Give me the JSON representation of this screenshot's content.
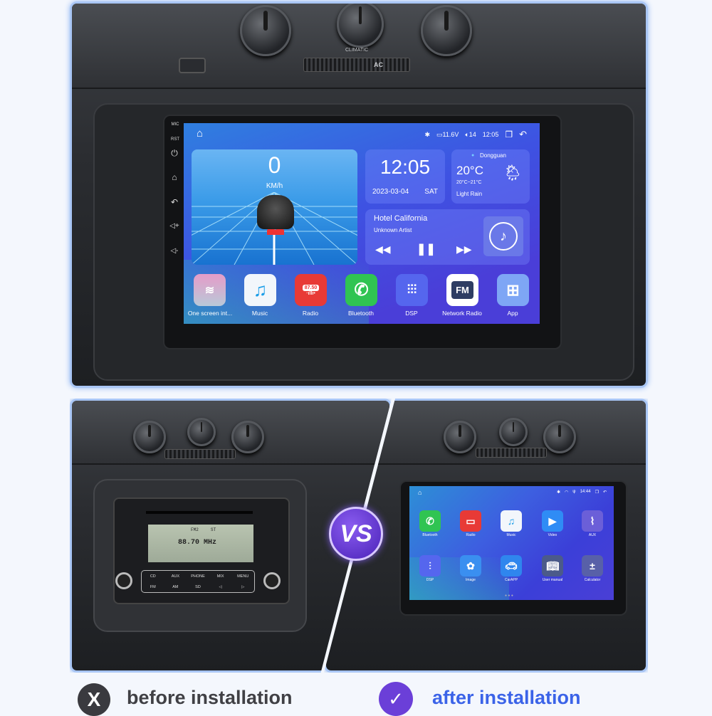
{
  "top_panel": {
    "climate_label": "CLIMATIC",
    "ac_label": "AC",
    "bezel_labels": {
      "mic": "MIC",
      "rst": "RST"
    },
    "status_bar": {
      "voltage": "11.6V",
      "volume": "14",
      "time": "12:05"
    },
    "speed": {
      "value": "0",
      "unit": "KM/h"
    },
    "clock": {
      "time": "12:05",
      "date": "2023-03-04",
      "day": "SAT"
    },
    "weather": {
      "city": "Dongguan",
      "temp": "20°C",
      "range": "20°C~21°C",
      "condition": "Light Rain"
    },
    "music": {
      "title": "Hotel California",
      "artist": "Unknown Artist"
    },
    "apps": [
      {
        "label": "One screen int...",
        "color": "#c5c7d8"
      },
      {
        "label": "Music",
        "color": "#f2f6fb"
      },
      {
        "label": "Radio",
        "color": "#e83a36",
        "freq": "87.50"
      },
      {
        "label": "Bluetooth",
        "color": "#30c452"
      },
      {
        "label": "DSP",
        "color": "#5566ee"
      },
      {
        "label": "Network Radio",
        "color": "#ffffff",
        "text": "FM"
      },
      {
        "label": "App",
        "color": "#7ea6f5"
      }
    ]
  },
  "before": {
    "display_band": "FM2",
    "display_st": "ST",
    "display_freq": "88.70 MHz",
    "buttons_row1": [
      "CD",
      "AUX",
      "PHONE",
      "MIX",
      "MENU"
    ],
    "buttons_row2": [
      "FM",
      "AM",
      "SD",
      "◁",
      "▷"
    ]
  },
  "after": {
    "status_time": "14:44",
    "apps": [
      {
        "label": "Bluetooth",
        "color": "#30c452"
      },
      {
        "label": "Radio",
        "color": "#e83a36"
      },
      {
        "label": "Music",
        "color": "#f2f6fb"
      },
      {
        "label": "Video",
        "color": "#2f8cf5"
      },
      {
        "label": "AUX",
        "color": "#6b5fd8"
      },
      {
        "label": "DSP",
        "color": "#5566ee"
      },
      {
        "label": "Image",
        "color": "#3a8ff0"
      },
      {
        "label": "CarAPP",
        "color": "#2f86ee"
      },
      {
        "label": "User manual",
        "color": "#4b5a8a"
      },
      {
        "label": "Calculator",
        "color": "#5860a8"
      }
    ]
  },
  "vs_badge": "VS",
  "captions": {
    "before": "before installation",
    "after": "after installation"
  },
  "colors": {
    "accent": "#3d5fe0",
    "after_text": "#3b63e8",
    "badge": "#6b3fd8"
  }
}
